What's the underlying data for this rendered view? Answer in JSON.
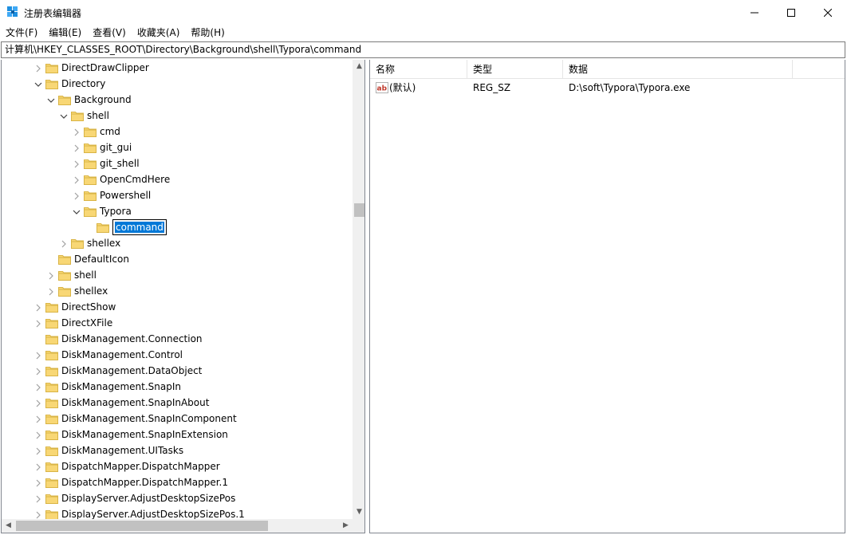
{
  "window": {
    "title": "注册表编辑器",
    "icon": "regedit-icon"
  },
  "menu": [
    "文件(F)",
    "编辑(E)",
    "查看(V)",
    "收藏夹(A)",
    "帮助(H)"
  ],
  "address": "计算机\\HKEY_CLASSES_ROOT\\Directory\\Background\\shell\\Typora\\command",
  "tree": [
    {
      "label": "DirectDrawClipper",
      "level": 0,
      "state": "collapsed"
    },
    {
      "label": "Directory",
      "level": 0,
      "state": "expanded"
    },
    {
      "label": "Background",
      "level": 1,
      "state": "expanded"
    },
    {
      "label": "shell",
      "level": 2,
      "state": "expanded"
    },
    {
      "label": "cmd",
      "level": 3,
      "state": "collapsed"
    },
    {
      "label": "git_gui",
      "level": 3,
      "state": "collapsed"
    },
    {
      "label": "git_shell",
      "level": 3,
      "state": "collapsed"
    },
    {
      "label": "OpenCmdHere",
      "level": 3,
      "state": "collapsed"
    },
    {
      "label": "Powershell",
      "level": 3,
      "state": "collapsed"
    },
    {
      "label": "Typora",
      "level": 3,
      "state": "expanded"
    },
    {
      "label": "command",
      "level": 4,
      "state": "leaf",
      "editing": true
    },
    {
      "label": "shellex",
      "level": 2,
      "state": "collapsed"
    },
    {
      "label": "DefaultIcon",
      "level": 1,
      "state": "leaf"
    },
    {
      "label": "shell",
      "level": 1,
      "state": "collapsed"
    },
    {
      "label": "shellex",
      "level": 1,
      "state": "collapsed"
    },
    {
      "label": "DirectShow",
      "level": 0,
      "state": "collapsed"
    },
    {
      "label": "DirectXFile",
      "level": 0,
      "state": "collapsed"
    },
    {
      "label": "DiskManagement.Connection",
      "level": 0,
      "state": "leaf"
    },
    {
      "label": "DiskManagement.Control",
      "level": 0,
      "state": "collapsed"
    },
    {
      "label": "DiskManagement.DataObject",
      "level": 0,
      "state": "collapsed"
    },
    {
      "label": "DiskManagement.SnapIn",
      "level": 0,
      "state": "collapsed"
    },
    {
      "label": "DiskManagement.SnapInAbout",
      "level": 0,
      "state": "collapsed"
    },
    {
      "label": "DiskManagement.SnapInComponent",
      "level": 0,
      "state": "collapsed"
    },
    {
      "label": "DiskManagement.SnapInExtension",
      "level": 0,
      "state": "collapsed"
    },
    {
      "label": "DiskManagement.UITasks",
      "level": 0,
      "state": "collapsed"
    },
    {
      "label": "DispatchMapper.DispatchMapper",
      "level": 0,
      "state": "collapsed"
    },
    {
      "label": "DispatchMapper.DispatchMapper.1",
      "level": 0,
      "state": "collapsed"
    },
    {
      "label": "DisplayServer.AdjustDesktopSizePos",
      "level": 0,
      "state": "collapsed"
    },
    {
      "label": "DisplayServer.AdjustDesktopSizePos.1",
      "level": 0,
      "state": "collapsed"
    }
  ],
  "list": {
    "headers": {
      "name": "名称",
      "type": "类型",
      "data": "数据"
    },
    "rows": [
      {
        "name": "(默认)",
        "type": "REG_SZ",
        "data": "D:\\soft\\Typora\\Typora.exe",
        "icon": "string-value-icon"
      }
    ]
  },
  "colors": {
    "folder": "#f8d775",
    "selection": "#0078d7",
    "scrollbar": "#f0f0f0",
    "thumb": "#c1c1c1"
  }
}
